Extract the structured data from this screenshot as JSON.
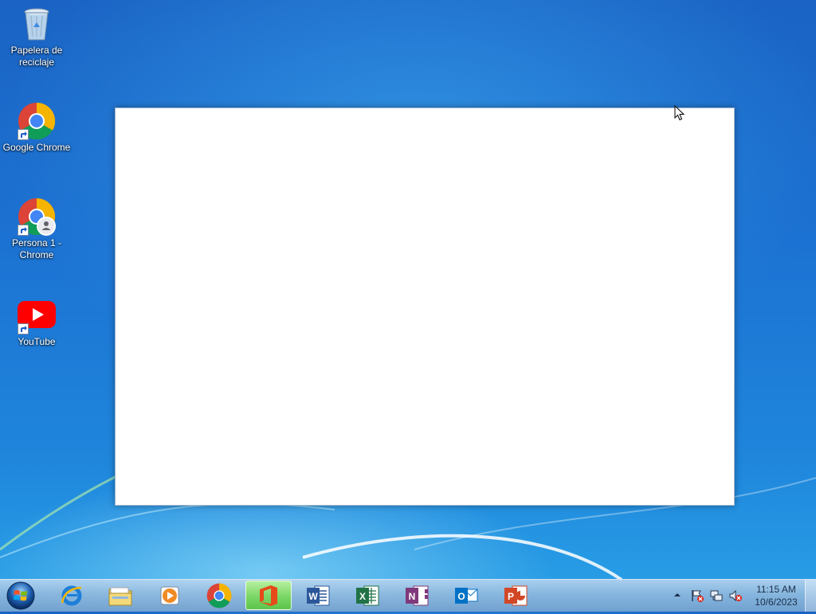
{
  "desktop": {
    "icons": [
      {
        "label": "Papelera de reciclaje",
        "icon": "recycle-bin-icon"
      },
      {
        "label": "Google Chrome",
        "icon": "chrome-icon"
      },
      {
        "label": "Persona 1 - Chrome",
        "icon": "chrome-profile-icon"
      },
      {
        "label": "YouTube",
        "icon": "youtube-icon"
      }
    ]
  },
  "window": {
    "state": "blank"
  },
  "taskbar": {
    "start": "start-orb-icon",
    "apps": [
      {
        "name": "internet-explorer-icon",
        "active": false
      },
      {
        "name": "file-explorer-icon",
        "active": false
      },
      {
        "name": "media-player-icon",
        "active": false
      },
      {
        "name": "chrome-icon",
        "active": false
      },
      {
        "name": "office-icon",
        "active": true
      },
      {
        "name": "word-icon",
        "active": false
      },
      {
        "name": "excel-icon",
        "active": false
      },
      {
        "name": "onenote-icon",
        "active": false
      },
      {
        "name": "outlook-icon",
        "active": false
      },
      {
        "name": "powerpoint-icon",
        "active": false
      }
    ],
    "clock": {
      "time": "11:15 AM",
      "date": "10/6/2023"
    }
  },
  "colors": {
    "active_task": "#7fd86a",
    "word": "#2b579a",
    "excel": "#217346",
    "onenote": "#80397b",
    "outlook": "#0072c6",
    "powerpoint": "#d24726",
    "office": "#e64a19"
  }
}
